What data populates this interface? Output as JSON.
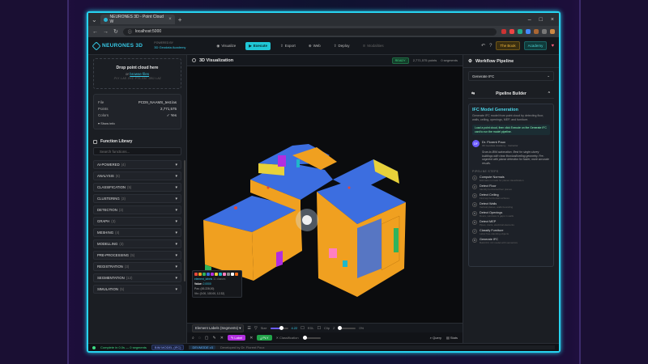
{
  "browser": {
    "tab_title": "NEURONES 3D - Point Cloud W",
    "url": "localhost:5000"
  },
  "header": {
    "logo": "NEURONES 3D",
    "powered_line1": "POWERED BY",
    "powered_line2": "3D Geodata Academy",
    "nav": [
      {
        "label": "Visualize",
        "icon": "eye-icon"
      },
      {
        "label": "Execute",
        "icon": "play-icon",
        "active": true
      },
      {
        "label": "Export",
        "icon": "export-icon"
      },
      {
        "label": "Web",
        "icon": "globe-icon"
      },
      {
        "label": "Deploy",
        "icon": "deploy-icon"
      },
      {
        "label": "Modalities",
        "icon": "layers-icon",
        "dim": true
      }
    ],
    "btn_book": "The Book",
    "btn_academy": "Academy"
  },
  "left": {
    "drop_title": "Drop point cloud here",
    "drop_or": "or",
    "drop_link": "browse files",
    "drop_formats": ".PLY .LAS .XYZ .PTS .E57 .OBJ .LAZ",
    "file_rows": [
      {
        "k": "File",
        "v": "PCD9_NAAMS_test.las"
      },
      {
        "k": "Points",
        "v": "2,771,575"
      },
      {
        "k": "Colors",
        "v": "✓ Yes"
      }
    ],
    "show_info": "▾ Show info",
    "fl_title": "Function Library",
    "fl_search_placeholder": "Search functions...",
    "categories": [
      {
        "name": "AI-POWERED",
        "count": "(4)"
      },
      {
        "name": "ANALYSIS",
        "count": "(6)"
      },
      {
        "name": "CLASSIFICATION",
        "count": "(5)"
      },
      {
        "name": "CLUSTERING",
        "count": "(3)"
      },
      {
        "name": "DETECTION",
        "count": "(3)"
      },
      {
        "name": "GRAPH",
        "count": "(3)"
      },
      {
        "name": "MESHING",
        "count": "(4)"
      },
      {
        "name": "MODELLING",
        "count": "(3)"
      },
      {
        "name": "PRE-PROCESSING",
        "count": "(5)"
      },
      {
        "name": "REGISTRATION",
        "count": "(3)"
      },
      {
        "name": "SEGMENTATION",
        "count": "(12)"
      },
      {
        "name": "SIMULATION",
        "count": "(5)"
      }
    ]
  },
  "center": {
    "title": "3D Visualization",
    "badge": "READY",
    "points": "2,771,575 points",
    "segments": "0 segments",
    "legend_label": "element_labels",
    "legend_count": "11 classes",
    "legend_value_label": "Value:",
    "legend_value": "2.0000",
    "legend_pos": "Pos: (45.228,00)",
    "legend_pos2": "Vtx: (0.00, 100.00, 12.32)",
    "swatch_colors": [
      "#e5483a",
      "#f0a020",
      "#2fb35c",
      "#3c6ee0",
      "#b22ee0",
      "#e8d13a",
      "#1fb8c9",
      "#ff7fbf",
      "#8a8a8a",
      "#ffffff",
      "#f06a1a"
    ],
    "select_label": "Element Labels (Segments) ▾",
    "size_label": "Size",
    "size_val": "4.22",
    "eds_label": "EDL",
    "clip_label": "Clip",
    "clip_axis": "Z",
    "pct": "0%",
    "pill_label": "Label",
    "pill_ply": "PLY",
    "classif_label": "Classification",
    "query_label": "Query",
    "stats_label": "Stats"
  },
  "right": {
    "wf_title": "Workflow Pipeline",
    "wf_select": "Generate IFC",
    "pb_title": "Pipeline Builder",
    "gen_title": "IFC Model Generation",
    "gen_desc": "Generate IFC model from point cloud by detecting floor, walls, ceiling, openings, MEP, and furniture.",
    "gen_note": "Load a point cloud, then click Execute on the Generate IFC card to run the model pipeline.",
    "author_initials": "DF",
    "author_name": "Dr. Florent Poux",
    "author_sub": "3D Geodata Academy · Instructor",
    "quote": "Scan-to-BIM automation. Best for single-storey buildings with clear floor/wall/ceiling geometry. Pre-segment with planar detection for faster, more accurate results.",
    "steps_title": "PIPELINE STEPS",
    "steps": [
      {
        "n": "1",
        "t": "Compute Normals",
        "d": "Estimate normals for planar classification"
      },
      {
        "n": "2",
        "t": "Detect Floor",
        "d": "Identify horizontal floor planes"
      },
      {
        "n": "3",
        "t": "Detect Ceiling",
        "d": "Find top horizontal surfaces"
      },
      {
        "n": "4",
        "t": "Detect Walls",
        "d": "Vertical planes, walls bounding"
      },
      {
        "n": "5",
        "t": "Detect Openings",
        "d": "Doors, windows & gaps in walls"
      },
      {
        "n": "6",
        "t": "Detect MEP",
        "d": "Pipes, ducts, electrical elements"
      },
      {
        "n": "7",
        "t": "Classify Furniture",
        "d": "Label free-standing objects"
      },
      {
        "n": "8",
        "t": "Generate IFC",
        "d": "Build IFC 4.0 model with semantics"
      }
    ]
  },
  "status": {
    "left": "Complete in 0.0s — 0 segments",
    "badge": "BIM MODEL (IFC)",
    "right_badge": "DEVMODE v3",
    "right_text": "Developed by Dr. Florent Poux"
  }
}
